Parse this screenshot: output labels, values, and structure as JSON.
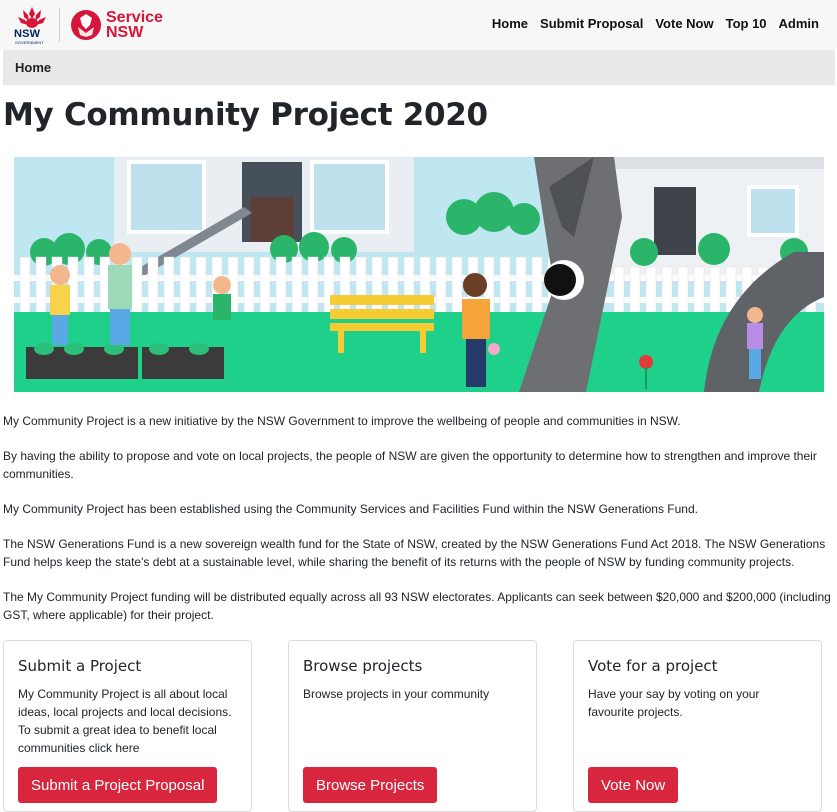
{
  "nav": {
    "nsw_logo_text": "NSW",
    "nsw_logo_sub": "GOVERNMENT",
    "brand_line1": "Service",
    "brand_line2": "NSW",
    "links": [
      "Home",
      "Submit Proposal",
      "Vote Now",
      "Top 10",
      "Admin"
    ]
  },
  "breadcrumb": {
    "current": "Home"
  },
  "page": {
    "title": "My Community Project 2020"
  },
  "intro": {
    "paragraphs": [
      "My Community Project is a new initiative by the NSW Government to improve the wellbeing of people and communities in NSW.",
      "By having the ability to propose and vote on local projects, the people of NSW are given the opportunity to determine how to strengthen and improve their communities.",
      "My Community Project has been established using the Community Services and Facilities Fund within the NSW Generations Fund.",
      "The NSW Generations Fund is a new sovereign wealth fund for the State of NSW, created by the NSW Generations Fund Act 2018. The NSW Generations Fund helps keep the state's debt at a sustainable level, while sharing the benefit of its returns with the people of NSW by funding community projects.",
      "The My Community Project funding will be distributed equally across all 93 NSW electorates. Applicants can seek between $20,000 and $200,000 (including GST, where applicable) for their project."
    ]
  },
  "cards": [
    {
      "title": "Submit a Project",
      "text": "My Community Project is all about local ideas, local projects and local decisions. To submit a great idea to benefit local communities click here",
      "button": "Submit a Project Proposal"
    },
    {
      "title": "Browse projects",
      "text": "Browse projects in your community",
      "button": "Browse Projects"
    },
    {
      "title": "Vote for a project",
      "text": "Have your say by voting on your favourite projects.",
      "button": "Vote Now"
    }
  ],
  "colors": {
    "brand_red": "#d7153a",
    "nsw_blue": "#002664",
    "button_red": "#d7263d"
  }
}
